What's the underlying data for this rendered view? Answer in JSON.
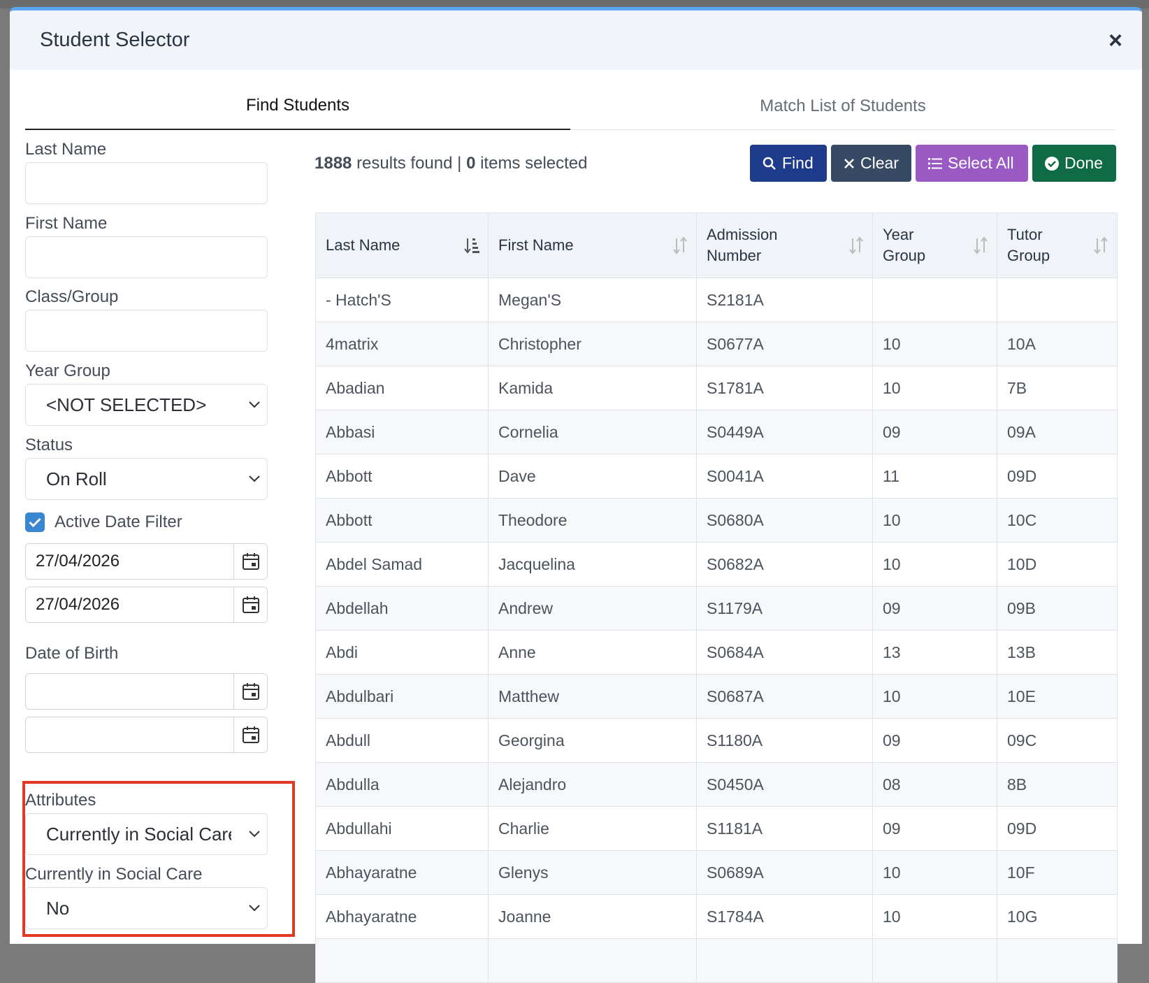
{
  "dialog": {
    "title": "Student Selector",
    "close_glyph": "×"
  },
  "tabs": [
    {
      "label": "Find Students"
    },
    {
      "label": "Match List of Students"
    }
  ],
  "filters": {
    "last_name_label": "Last Name",
    "last_name_value": "",
    "first_name_label": "First Name",
    "first_name_value": "",
    "class_group_label": "Class/Group",
    "class_group_value": "",
    "year_group_label": "Year Group",
    "year_group_value": "<NOT SELECTED>",
    "status_label": "Status",
    "status_value": "On Roll",
    "active_date_label": "Active Date Filter",
    "active_date_checked": true,
    "active_date_from": "27/04/2026",
    "active_date_to": "27/04/2026",
    "dob_label": "Date of Birth",
    "dob_from": "",
    "dob_to": "",
    "attributes_label": "Attributes",
    "attributes_value": "Currently in Social Care",
    "social_care_label": "Currently in Social Care",
    "social_care_value": "No"
  },
  "results": {
    "count": "1888",
    "count_text": "results found",
    "selected": "0",
    "selected_text": "items selected",
    "separator": "|"
  },
  "buttons": {
    "find": "Find",
    "clear": "Clear",
    "select_all": "Select All",
    "done": "Done"
  },
  "table": {
    "headers": [
      {
        "line1": "",
        "line2": "Last Name"
      },
      {
        "line1": "",
        "line2": "First Name"
      },
      {
        "line1": "Admission",
        "line2": "Number"
      },
      {
        "line1": "Year",
        "line2": "Group"
      },
      {
        "line1": "Tutor",
        "line2": "Group"
      }
    ],
    "rows": [
      [
        "- Hatch'S",
        "Megan'S",
        "S2181A",
        "",
        ""
      ],
      [
        "4matrix",
        "Christopher",
        "S0677A",
        "10",
        "10A"
      ],
      [
        "Abadian",
        "Kamida",
        "S1781A",
        "10",
        "7B"
      ],
      [
        "Abbasi",
        "Cornelia",
        "S0449A",
        "09",
        "09A"
      ],
      [
        "Abbott",
        "Dave",
        "S0041A",
        "11",
        "09D"
      ],
      [
        "Abbott",
        "Theodore",
        "S0680A",
        "10",
        "10C"
      ],
      [
        "Abdel Samad",
        "Jacquelina",
        "S0682A",
        "10",
        "10D"
      ],
      [
        "Abdellah",
        "Andrew",
        "S1179A",
        "09",
        "09B"
      ],
      [
        "Abdi",
        "Anne",
        "S0684A",
        "13",
        "13B"
      ],
      [
        "Abdulbari",
        "Matthew",
        "S0687A",
        "10",
        "10E"
      ],
      [
        "Abdull",
        "Georgina",
        "S1180A",
        "09",
        "09C"
      ],
      [
        "Abdulla",
        "Alejandro",
        "S0450A",
        "08",
        "8B"
      ],
      [
        "Abdullahi",
        "Charlie",
        "S1181A",
        "09",
        "09D"
      ],
      [
        "Abhayaratne",
        "Glenys",
        "S0689A",
        "10",
        "10F"
      ],
      [
        "Abhayaratne",
        "Joanne",
        "S1784A",
        "10",
        "10G"
      ],
      [
        "",
        "",
        "",
        "",
        ""
      ]
    ]
  },
  "colors": {
    "accent": "#5aa7f0",
    "find_button": "#1e3a8a",
    "clear_button": "#374a63",
    "select_all_button": "#9b59c4",
    "done_button": "#0f6a46",
    "highlight_border": "#e03a22",
    "checkbox": "#3a86d0"
  },
  "icons": {
    "find": "search-icon",
    "clear": "x-icon",
    "select_all": "list-icon",
    "done": "check-circle-icon",
    "date": "calendar-icon",
    "sort": "sort-icon"
  }
}
